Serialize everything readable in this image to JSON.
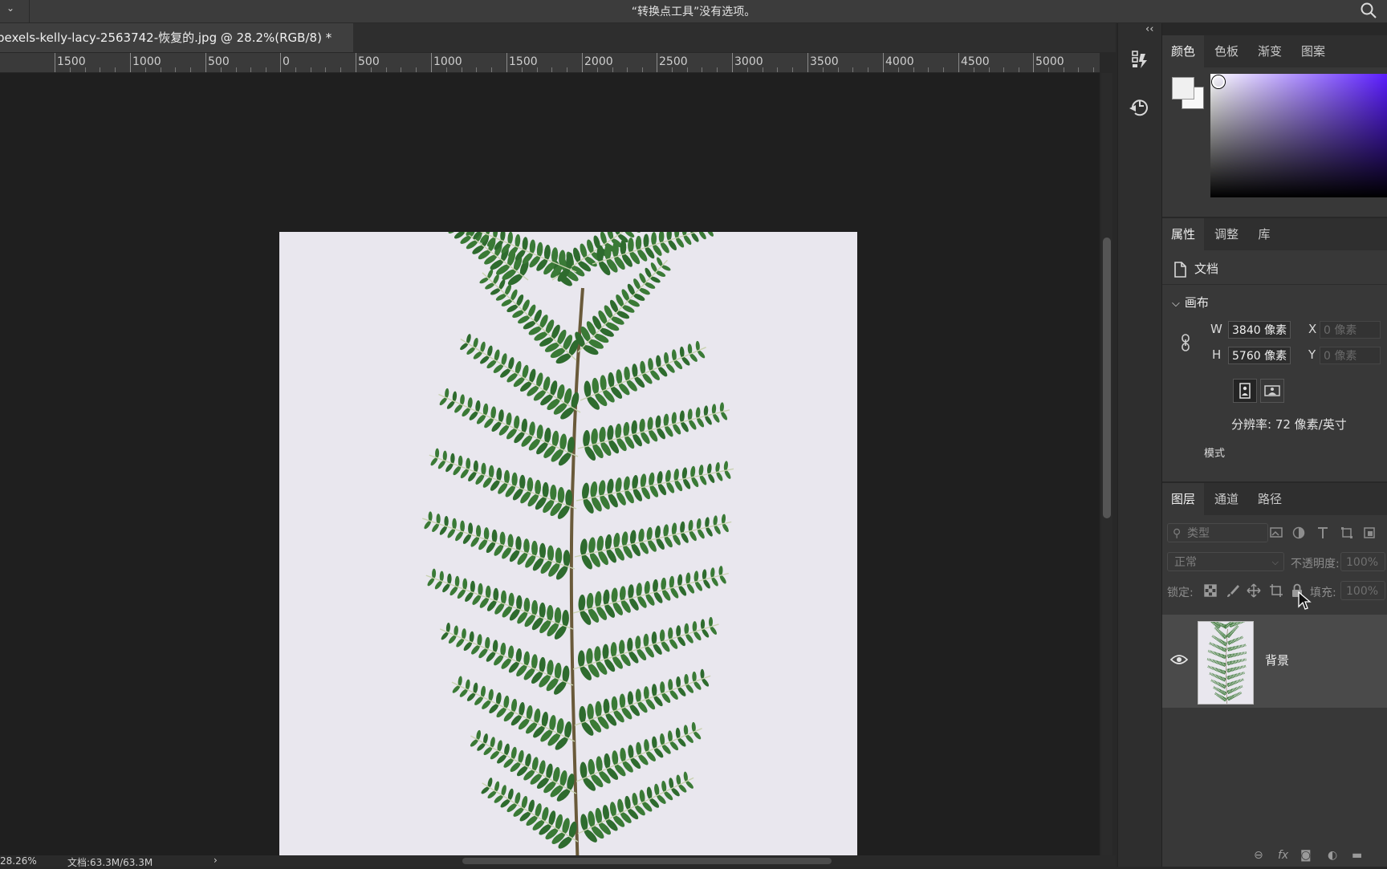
{
  "options_bar": {
    "hint": "“转换点工具”没有选项。",
    "menu_chevron": "⌄"
  },
  "document_tab": {
    "title": "pexels-kelly-lacy-2563742-恢复的.jpg @ 28.2%(RGB/8) *"
  },
  "ruler": {
    "labels": [
      "1500",
      "1000",
      "500",
      "0",
      "500",
      "1000",
      "1500",
      "2000",
      "2500",
      "3000",
      "3500",
      "4000",
      "4500",
      "5000"
    ]
  },
  "status_bar": {
    "zoom": "28.26%",
    "doc_size": "文档:63.3M/63.3M",
    "arrow": "›"
  },
  "icon_strip": {
    "collapse": "‹‹",
    "icons": [
      "history-brush-icon",
      "history-icon"
    ]
  },
  "color_panel": {
    "tabs": [
      "颜色",
      "色板",
      "渐变",
      "图案"
    ],
    "active_tab": "颜色",
    "foreground": "#f0f0f0",
    "background": "#f8f8f8",
    "hue_color": "#5b1dff"
  },
  "properties_panel": {
    "tabs": [
      "属性",
      "调整",
      "库"
    ],
    "doc_label": "文档",
    "section": "画布",
    "width_label": "W",
    "width_value": "3840 像素",
    "height_label": "H",
    "height_value": "5760 像素",
    "x_label": "X",
    "x_value": "0 像素",
    "y_label": "Y",
    "y_value": "0 像素",
    "resolution": "分辨率: 72 像素/英寸",
    "mode": "模式"
  },
  "layers_panel": {
    "tabs": [
      "图层",
      "通道",
      "路径"
    ],
    "filter_placeholder": "类型",
    "blend_mode": "正常",
    "opacity_label": "不透明度:",
    "opacity_value": "100%",
    "lock_label": "锁定:",
    "fill_label": "填充:",
    "fill_value": "100%",
    "layer_name": "背景",
    "bottom_icons": [
      "link-icon",
      "fx-icon",
      "mask-icon",
      "adjustment-icon",
      "folder-icon"
    ]
  }
}
